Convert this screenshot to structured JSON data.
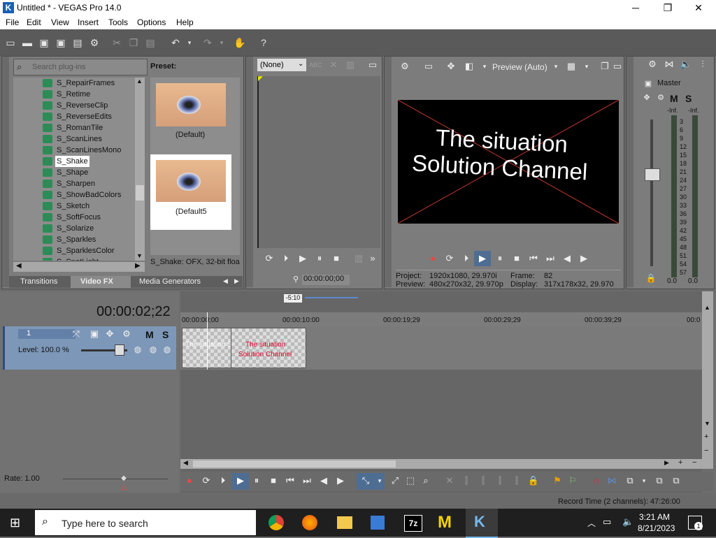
{
  "window": {
    "title": "Untitled * - VEGAS Pro 14.0",
    "minimize": "─",
    "maximize": "❐",
    "close": "✕"
  },
  "menu": [
    "File",
    "Edit",
    "View",
    "Insert",
    "Tools",
    "Options",
    "Help"
  ],
  "plugins": {
    "search_placeholder": "Search plug-ins",
    "items": [
      "S_RepairFrames",
      "S_Retime",
      "S_ReverseClip",
      "S_ReverseEdits",
      "S_RomanTile",
      "S_ScanLines",
      "S_ScanLinesMono",
      "S_Shake",
      "S_Shape",
      "S_Sharpen",
      "S_ShowBadColors",
      "S_Sketch",
      "S_SoftFocus",
      "S_Solarize",
      "S_Sparkles",
      "S_SparklesColor",
      "S_SpotLight"
    ],
    "selected": "S_Shake",
    "tabs": [
      "Transitions",
      "Video FX",
      "Media Generators"
    ],
    "active_tab": "Video FX"
  },
  "preset": {
    "label": "Preset:",
    "items": [
      "(Default)",
      "(Default5"
    ],
    "status": "S_Shake: OFX, 32-bit floa"
  },
  "trimmer": {
    "dropdown": "(None)",
    "timecode": "00:00:00;00"
  },
  "preview": {
    "mode": "Preview (Auto)",
    "text_line1": "The situation",
    "text_line2": "Solution Channel",
    "project_label": "Project:",
    "project_value": "1920x1080, 29.970i",
    "preview_label": "Preview:",
    "preview_value": "480x270x32, 29.970p",
    "frame_label": "Frame:",
    "frame_value": "82",
    "display_label": "Display:",
    "display_value": "317x178x32, 29.970"
  },
  "mixer": {
    "master": "Master",
    "m": "M",
    "s": "S",
    "inf_left": "-Inf.",
    "inf_right": "-Inf.",
    "scale": [
      "3",
      "6",
      "9",
      "12",
      "15",
      "18",
      "21",
      "24",
      "27",
      "30",
      "33",
      "36",
      "39",
      "42",
      "45",
      "48",
      "51",
      "54",
      "57"
    ],
    "bottom_left": "0.0",
    "bottom_right": "0.0"
  },
  "timeline": {
    "timecode": "00:00:02;22",
    "ruler": [
      "00:00:00;00",
      "00:00:10:00",
      "00:00:19;29",
      "00:00:29;29",
      "00:00:39;29",
      "00:0"
    ],
    "marker": "-5:10",
    "track_number": "1",
    "track_m": "M",
    "track_s": "S",
    "level": "Level: 100.0 %",
    "clip1_text": "The situation Solution Ch",
    "clip2_text_line1": "The situation",
    "clip2_text_line2": "Solution Channel",
    "rate": "Rate: 1.00",
    "record_time": "Record Time (2 channels): 47:26:00"
  },
  "taskbar": {
    "search_placeholder": "Type here to search",
    "time": "3:21 AM",
    "date": "8/21/2023",
    "notif": "1",
    "app_7z": "7z"
  },
  "colors": {
    "accent": "#1a5fb4",
    "preview_cross": "#c0392b",
    "clip_text": "#e0002a"
  }
}
